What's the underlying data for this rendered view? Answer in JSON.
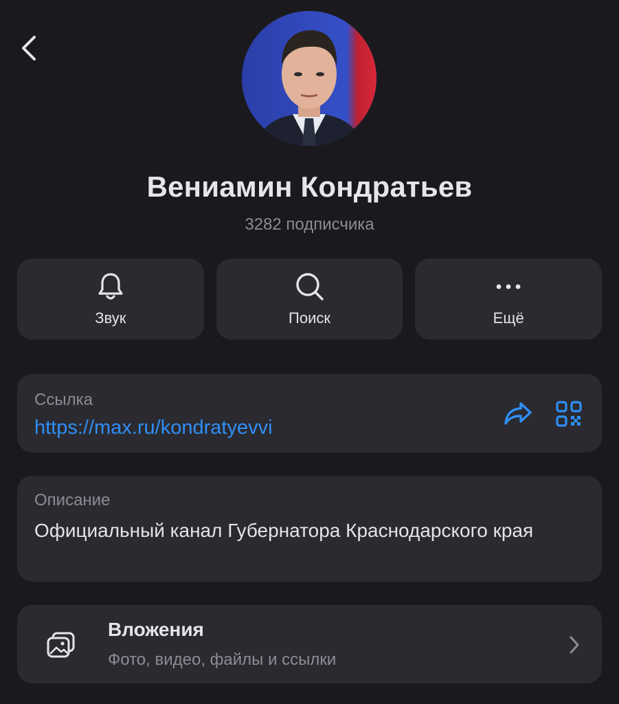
{
  "header": {
    "back_icon": "chevron-left-icon"
  },
  "profile": {
    "avatar_alt": "avatar photo",
    "name": "Вениамин Кондратьев",
    "subscribers": "3282 подписчика"
  },
  "actions": [
    {
      "label": "Звук",
      "icon": "bell-icon"
    },
    {
      "label": "Поиск",
      "icon": "search-icon"
    },
    {
      "label": "Ещё",
      "icon": "more-dots-icon"
    }
  ],
  "link": {
    "caption": "Ссылка",
    "url": "https://max.ru/kondratyevvi",
    "share_icon": "share-arrow-icon",
    "qr_icon": "qr-code-icon"
  },
  "description": {
    "caption": "Описание",
    "text": "Официальный канал Губернатора Краснодарского края"
  },
  "attachments": {
    "title": "Вложения",
    "subtitle": "Фото, видео, файлы и ссылки",
    "icon": "gallery-icon",
    "chevron": "chevron-right-icon"
  },
  "colors": {
    "background": "#1a1a1e",
    "card": "#2a2a30",
    "accent": "#2f8ff5",
    "secondary_text": "#8c8c94"
  }
}
